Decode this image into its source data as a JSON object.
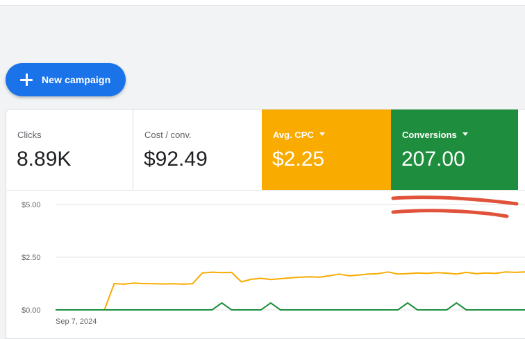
{
  "toolbar": {
    "new_campaign_label": "New campaign"
  },
  "metrics": [
    {
      "label": "Clicks",
      "value": "8.89K"
    },
    {
      "label": "Cost / conv.",
      "value": "$92.49"
    },
    {
      "label": "Avg. CPC",
      "value": "$2.25",
      "color": "#f9ab00"
    },
    {
      "label": "Conversions",
      "value": "207.00",
      "color": "#1e8e3e"
    }
  ],
  "colors": {
    "accent": "#1a73e8",
    "avg_cpc": "#f9ab00",
    "conversions": "#1e8e3e",
    "annotation": "#e0533a"
  },
  "chart_data": {
    "type": "line",
    "y_tick_labels": [
      "$5.00",
      "$2.50",
      "$0.00"
    ],
    "x_tick_labels": [
      "Sep 7, 2024"
    ],
    "ylim": [
      0,
      5
    ],
    "grid": true,
    "x": [
      0,
      1,
      2,
      3,
      4,
      5,
      6,
      7,
      8,
      9,
      10,
      11,
      12,
      13,
      14,
      15,
      16,
      17,
      18,
      19,
      20,
      21,
      22,
      23,
      24,
      25,
      26,
      27,
      28,
      29,
      30,
      31,
      32,
      33,
      34,
      35,
      36,
      37,
      38,
      39,
      40,
      41,
      42,
      43,
      44,
      45,
      46,
      47,
      48
    ],
    "series": [
      {
        "color": "#f9ab00",
        "values": [
          0,
          0,
          0,
          0,
          0,
          0,
          1.25,
          1.22,
          1.27,
          1.25,
          1.24,
          1.23,
          1.24,
          1.22,
          1.24,
          1.75,
          1.79,
          1.77,
          1.78,
          1.33,
          1.45,
          1.5,
          1.44,
          1.48,
          1.52,
          1.55,
          1.57,
          1.55,
          1.62,
          1.7,
          1.62,
          1.65,
          1.7,
          1.72,
          1.8,
          1.7,
          1.72,
          1.75,
          1.73,
          1.77,
          1.74,
          1.7,
          1.78,
          1.72,
          1.75,
          1.73,
          1.8,
          1.78,
          1.8
        ]
      },
      {
        "color": "#1e8e3e",
        "values": [
          0,
          0,
          0,
          0,
          0,
          0,
          0,
          0,
          0,
          0,
          0,
          0,
          0,
          0,
          0,
          0,
          0,
          0.33,
          0,
          0,
          0,
          0,
          0.33,
          0,
          0,
          0,
          0,
          0,
          0,
          0,
          0,
          0,
          0,
          0,
          0,
          0,
          0.33,
          0,
          0,
          0,
          0,
          0.33,
          0,
          0,
          0,
          0,
          0,
          0,
          0
        ]
      }
    ]
  }
}
